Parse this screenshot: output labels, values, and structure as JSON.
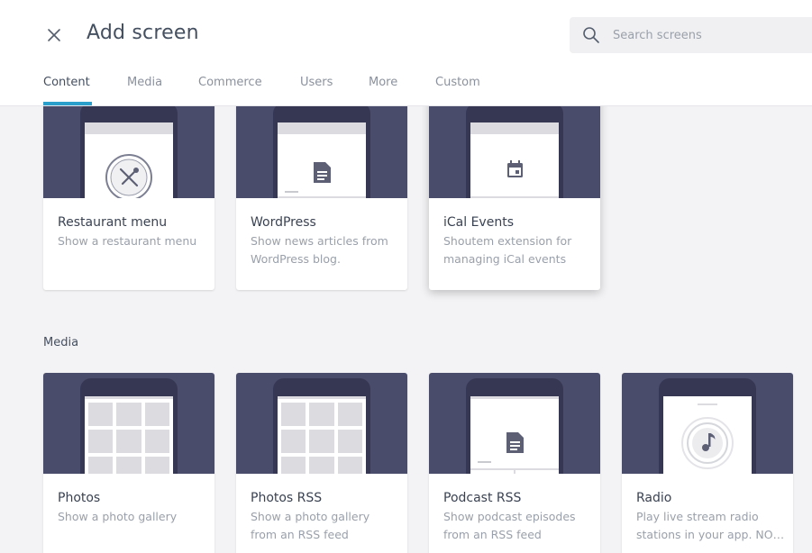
{
  "header": {
    "title": "Add screen"
  },
  "search": {
    "placeholder": "Search screens",
    "value": ""
  },
  "tabs": [
    {
      "label": "Content",
      "active": true
    },
    {
      "label": "Media",
      "active": false
    },
    {
      "label": "Commerce",
      "active": false
    },
    {
      "label": "Users",
      "active": false
    },
    {
      "label": "More",
      "active": false
    },
    {
      "label": "Custom",
      "active": false
    }
  ],
  "content_cards": [
    {
      "name": "Restaurant menu",
      "desc": "Show a restaurant menu",
      "icon": "restaurant-icon"
    },
    {
      "name": "WordPress",
      "desc": "Show news articles from WordPress blog.",
      "icon": "document-icon"
    },
    {
      "name": "iCal Events",
      "desc": "Shoutem extension for managing iCal events",
      "icon": "calendar-icon"
    }
  ],
  "media_section": {
    "label": "Media"
  },
  "media_cards": [
    {
      "name": "Photos",
      "desc": "Show a photo gallery",
      "icon": "photo-grid-icon"
    },
    {
      "name": "Photos RSS",
      "desc": "Show a photo gallery from an RSS feed",
      "icon": "photo-grid-icon"
    },
    {
      "name": "Podcast RSS",
      "desc": "Show podcast episodes from an RSS feed",
      "icon": "document-icon"
    },
    {
      "name": "Radio",
      "desc": "Play live stream radio stations in your app. NO…",
      "icon": "music-note-icon"
    }
  ],
  "colors": {
    "accent": "#2b9fcc",
    "thumb_bg": "#4a4c6b",
    "phone": "#363753",
    "page_bg": "#f3f3f5"
  }
}
